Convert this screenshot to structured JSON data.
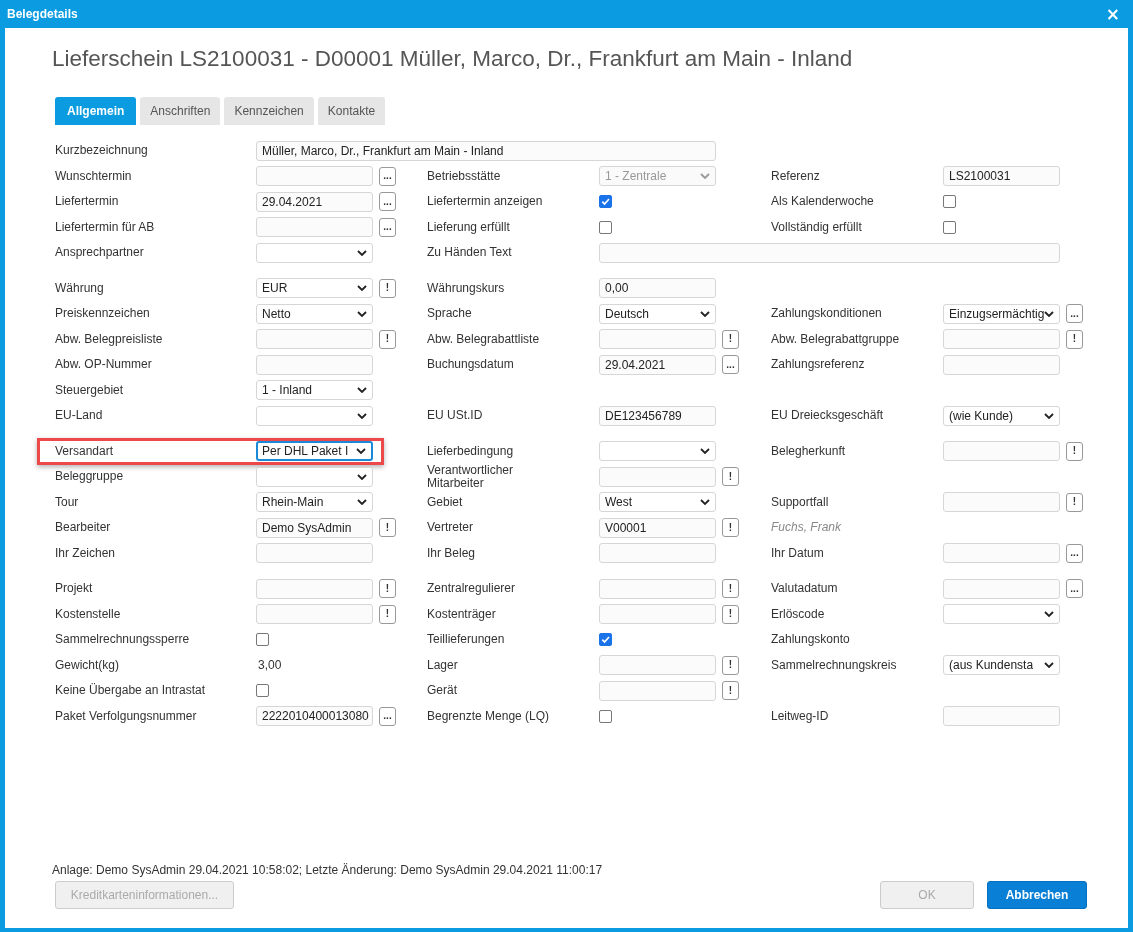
{
  "window": {
    "title": "Belegdetails",
    "close": "×"
  },
  "heading": "Lieferschein LS2100031 - D00001 Müller, Marco, Dr., Frankfurt am Main - Inland",
  "tabs": [
    {
      "label": "Allgemein",
      "selected": true
    },
    {
      "label": "Anschriften",
      "selected": false
    },
    {
      "label": "Kennzeichen",
      "selected": false
    },
    {
      "label": "Kontakte",
      "selected": false
    }
  ],
  "sections": [
    {
      "rows": [
        [
          {
            "label": "Kurzbezeichnung",
            "control": {
              "kind": "text",
              "value": "Müller, Marco, Dr., Frankfurt am Main - Inland",
              "wide": true
            }
          },
          null,
          null
        ],
        [
          {
            "label": "Wunschtermin",
            "control": {
              "kind": "text"
            },
            "button": "..."
          },
          {
            "label": "Betriebsstätte",
            "control": {
              "kind": "select",
              "value": "1 - Zentrale",
              "disabled": true
            }
          },
          {
            "label": "Referenz",
            "control": {
              "kind": "text",
              "value": "LS2100031"
            }
          }
        ],
        [
          {
            "label": "Liefertermin",
            "control": {
              "kind": "text",
              "value": "29.04.2021"
            },
            "button": "..."
          },
          {
            "label": "Liefertermin anzeigen",
            "control": {
              "kind": "check",
              "checked": true
            }
          },
          {
            "label": "Als Kalenderwoche",
            "control": {
              "kind": "check",
              "checked": false
            }
          }
        ],
        [
          {
            "label": "Liefertermin für AB",
            "control": {
              "kind": "text"
            },
            "button": "..."
          },
          {
            "label": "Lieferung erfüllt",
            "control": {
              "kind": "check",
              "checked": false
            }
          },
          {
            "label": "Vollständig erfüllt",
            "control": {
              "kind": "check",
              "checked": false
            }
          }
        ],
        [
          {
            "label": "Ansprechpartner",
            "control": {
              "kind": "select"
            }
          },
          {
            "label": "Zu Händen Text",
            "control": {
              "kind": "text",
              "wide": true
            }
          },
          null
        ]
      ]
    },
    {
      "rows": [
        [
          {
            "label": "Währung",
            "control": {
              "kind": "select",
              "value": "EUR"
            },
            "button": "!"
          },
          {
            "label": "Währungskurs",
            "control": {
              "kind": "text",
              "value": "0,00"
            }
          },
          null
        ],
        [
          {
            "label": "Preiskennzeichen",
            "control": {
              "kind": "select",
              "value": "Netto"
            }
          },
          {
            "label": "Sprache",
            "control": {
              "kind": "select",
              "value": "Deutsch"
            }
          },
          {
            "label": "Zahlungskonditionen",
            "control": {
              "kind": "select",
              "value": "Einzugsermächtig"
            },
            "button": "..."
          }
        ],
        [
          {
            "label": "Abw. Belegpreisliste",
            "control": {
              "kind": "text"
            },
            "button": "!"
          },
          {
            "label": "Abw. Belegrabattliste",
            "control": {
              "kind": "text"
            },
            "button": "!"
          },
          {
            "label": "Abw. Belegrabattgruppe",
            "control": {
              "kind": "text"
            },
            "button": "!"
          }
        ],
        [
          {
            "label": "Abw. OP-Nummer",
            "control": {
              "kind": "text"
            }
          },
          {
            "label": "Buchungsdatum",
            "control": {
              "kind": "text",
              "value": "29.04.2021"
            },
            "button": "..."
          },
          {
            "label": "Zahlungsreferenz",
            "control": {
              "kind": "text"
            }
          }
        ],
        [
          {
            "label": "Steuergebiet",
            "control": {
              "kind": "select",
              "value": "1 - Inland"
            }
          },
          null,
          null
        ],
        [
          {
            "label": "EU-Land",
            "control": {
              "kind": "select"
            }
          },
          {
            "label": "EU USt.ID",
            "control": {
              "kind": "text",
              "value": "DE123456789"
            }
          },
          {
            "label": "EU Dreiecksgeschäft",
            "control": {
              "kind": "select",
              "value": "(wie Kunde)"
            }
          }
        ]
      ]
    },
    {
      "rows": [
        [
          {
            "label": "Versandart",
            "control": {
              "kind": "select",
              "value": "Per DHL Paket I"
            },
            "highlighted": true
          },
          {
            "label": "Lieferbedingung",
            "control": {
              "kind": "select"
            }
          },
          {
            "label": "Belegherkunft",
            "control": {
              "kind": "text"
            },
            "button": "!"
          }
        ],
        [
          {
            "label": "Beleggruppe",
            "control": {
              "kind": "select"
            }
          },
          {
            "label": "Verantwortlicher\nMitarbeiter",
            "control": {
              "kind": "text"
            },
            "button": "!"
          },
          null
        ],
        [
          {
            "label": "Tour",
            "control": {
              "kind": "select",
              "value": "Rhein-Main"
            }
          },
          {
            "label": "Gebiet",
            "control": {
              "kind": "select",
              "value": "West"
            }
          },
          {
            "label": "Supportfall",
            "control": {
              "kind": "text"
            },
            "button": "!"
          }
        ],
        [
          {
            "label": "Bearbeiter",
            "control": {
              "kind": "text",
              "value": "Demo SysAdmin"
            },
            "button": "!"
          },
          {
            "label": "Vertreter",
            "control": {
              "kind": "text",
              "value": "V00001"
            },
            "button": "!"
          },
          {
            "label": "Fuchs, Frank",
            "kind": "note"
          }
        ],
        [
          {
            "label": "Ihr Zeichen",
            "control": {
              "kind": "text"
            }
          },
          {
            "label": "Ihr Beleg",
            "control": {
              "kind": "text"
            }
          },
          {
            "label": "Ihr Datum",
            "control": {
              "kind": "text"
            },
            "button": "..."
          }
        ]
      ]
    },
    {
      "rows": [
        [
          {
            "label": "Projekt",
            "control": {
              "kind": "text"
            },
            "button": "!"
          },
          {
            "label": "Zentralregulierer",
            "control": {
              "kind": "text"
            },
            "button": "!"
          },
          {
            "label": "Valutadatum",
            "control": {
              "kind": "text"
            },
            "button": "..."
          }
        ],
        [
          {
            "label": "Kostenstelle",
            "control": {
              "kind": "text"
            },
            "button": "!"
          },
          {
            "label": "Kostenträger",
            "control": {
              "kind": "text"
            },
            "button": "!"
          },
          {
            "label": "Erlöscode",
            "control": {
              "kind": "select"
            }
          }
        ],
        [
          {
            "label": "Sammelrechnungssperre",
            "control": {
              "kind": "check",
              "checked": false
            }
          },
          {
            "label": "Teillieferungen",
            "control": {
              "kind": "check",
              "checked": true
            }
          },
          {
            "label": "Zahlungskonto"
          }
        ],
        [
          {
            "label": "Gewicht(kg)",
            "control": {
              "kind": "display",
              "value": "3,00"
            }
          },
          {
            "label": "Lager",
            "control": {
              "kind": "text"
            },
            "button": "!"
          },
          {
            "label": "Sammelrechnungskreis",
            "control": {
              "kind": "select",
              "value": "(aus Kundensta"
            }
          }
        ],
        [
          {
            "label": "Keine Übergabe an Intrastat",
            "control": {
              "kind": "check",
              "checked": false
            }
          },
          {
            "label": "Gerät",
            "control": {
              "kind": "text"
            },
            "button": "!"
          },
          null
        ],
        [
          {
            "label": "Paket Verfolgungsnummer",
            "control": {
              "kind": "text",
              "value": "2222010400013080"
            },
            "button": "..."
          },
          {
            "label": "Begrenzte Menge (LQ)",
            "control": {
              "kind": "check",
              "checked": false
            }
          },
          {
            "label": "Leitweg-ID",
            "control": {
              "kind": "text"
            }
          }
        ]
      ]
    }
  ],
  "footer": {
    "info": "Anlage: Demo SysAdmin 29.04.2021 10:58:02; Letzte Änderung: Demo SysAdmin 29.04.2021 11:00:17",
    "buttons": [
      {
        "label": "Kreditkarteninformationen...",
        "kind": "secondary",
        "disabled": true
      },
      {
        "label": "OK",
        "kind": "secondary",
        "disabled": true
      },
      {
        "label": "Abbrechen",
        "kind": "primary",
        "disabled": false
      }
    ]
  }
}
